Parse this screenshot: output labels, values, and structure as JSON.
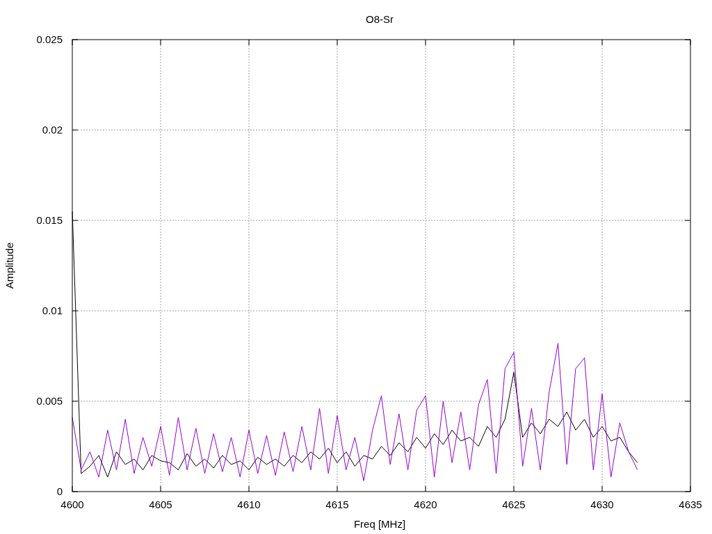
{
  "plot": {
    "chart_data": {
      "type": "line",
      "title": "O8-Sr",
      "xlabel": "Freq [MHz]",
      "ylabel": "Amplitude",
      "grid": true,
      "xlim": [
        4600,
        4635
      ],
      "ylim": [
        0,
        0.025
      ],
      "xticks": [
        4600,
        4605,
        4610,
        4615,
        4620,
        4625,
        4630,
        4635
      ],
      "yticks": [
        0,
        0.005,
        0.01,
        0.015,
        0.02,
        0.025
      ],
      "x": [
        4600,
        4600.5,
        4601,
        4601.5,
        4602,
        4602.5,
        4603,
        4603.5,
        4604,
        4604.5,
        4605,
        4605.5,
        4606,
        4606.5,
        4607,
        4607.5,
        4608,
        4608.5,
        4609,
        4609.5,
        4610,
        4610.5,
        4611,
        4611.5,
        4612,
        4612.5,
        4613,
        4613.5,
        4614,
        4614.5,
        4615,
        4615.5,
        4616,
        4616.5,
        4617,
        4617.5,
        4618,
        4618.5,
        4619,
        4619.5,
        4620,
        4620.5,
        4621,
        4621.5,
        4622,
        4622.5,
        4623,
        4623.5,
        4624,
        4624.5,
        4625,
        4625.5,
        4626,
        4626.5,
        4627,
        4627.5,
        4628,
        4628.5,
        4629,
        4629.5,
        4630,
        4630.5,
        4631,
        4631.5,
        4632
      ],
      "series": [
        {
          "color": "#9400d3",
          "values": [
            0.0041,
            0.0012,
            0.0022,
            0.0008,
            0.0034,
            0.0012,
            0.004,
            0.001,
            0.003,
            0.0014,
            0.0036,
            0.0009,
            0.0041,
            0.0012,
            0.0035,
            0.001,
            0.0032,
            0.0011,
            0.003,
            0.0008,
            0.0034,
            0.001,
            0.0031,
            0.0009,
            0.0033,
            0.0011,
            0.0036,
            0.0012,
            0.0046,
            0.001,
            0.0042,
            0.0012,
            0.003,
            0.0006,
            0.0034,
            0.0053,
            0.0015,
            0.0043,
            0.0012,
            0.0045,
            0.0053,
            0.0008,
            0.005,
            0.0016,
            0.0044,
            0.0012,
            0.0048,
            0.0062,
            0.001,
            0.0068,
            0.0077,
            0.0014,
            0.0046,
            0.0012,
            0.0055,
            0.0082,
            0.0015,
            0.0068,
            0.0074,
            0.0012,
            0.0054,
            0.0008,
            0.0038,
            0.0022,
            0.0012
          ]
        },
        {
          "color": "#000000",
          "values": [
            0.0155,
            0.001,
            0.0014,
            0.002,
            0.0008,
            0.0022,
            0.0015,
            0.0018,
            0.0012,
            0.002,
            0.0017,
            0.0016,
            0.0012,
            0.0021,
            0.0014,
            0.0018,
            0.0013,
            0.002,
            0.0015,
            0.0017,
            0.0012,
            0.0019,
            0.0015,
            0.0018,
            0.0014,
            0.002,
            0.0016,
            0.0022,
            0.0018,
            0.0024,
            0.0016,
            0.0022,
            0.0014,
            0.002,
            0.0018,
            0.0025,
            0.002,
            0.0027,
            0.0022,
            0.003,
            0.0024,
            0.0032,
            0.0026,
            0.0034,
            0.0028,
            0.003,
            0.0025,
            0.0036,
            0.003,
            0.004,
            0.0066,
            0.003,
            0.0038,
            0.0032,
            0.004,
            0.0036,
            0.0044,
            0.0034,
            0.004,
            0.003,
            0.0036,
            0.0028,
            0.003,
            0.0022,
            0.0016
          ]
        }
      ]
    }
  }
}
